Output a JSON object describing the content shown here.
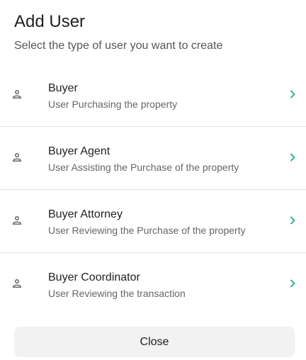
{
  "dialog": {
    "title": "Add User",
    "subtitle": "Select the type of user you want to create",
    "close_label": "Close"
  },
  "user_types": [
    {
      "name": "Buyer",
      "description": "User Purchasing the property",
      "icon": "person-icon"
    },
    {
      "name": "Buyer Agent",
      "description": "User Assisting the Purchase of the property",
      "icon": "person-icon"
    },
    {
      "name": "Buyer Attorney",
      "description": "User Reviewing the Purchase of the property",
      "icon": "person-icon"
    },
    {
      "name": "Buyer Coordinator",
      "description": "User Reviewing the transaction",
      "icon": "person-icon"
    }
  ],
  "colors": {
    "chevron": "#1aab8a",
    "icon": "#6b6b6b",
    "button_bg": "#f2f2f2"
  }
}
